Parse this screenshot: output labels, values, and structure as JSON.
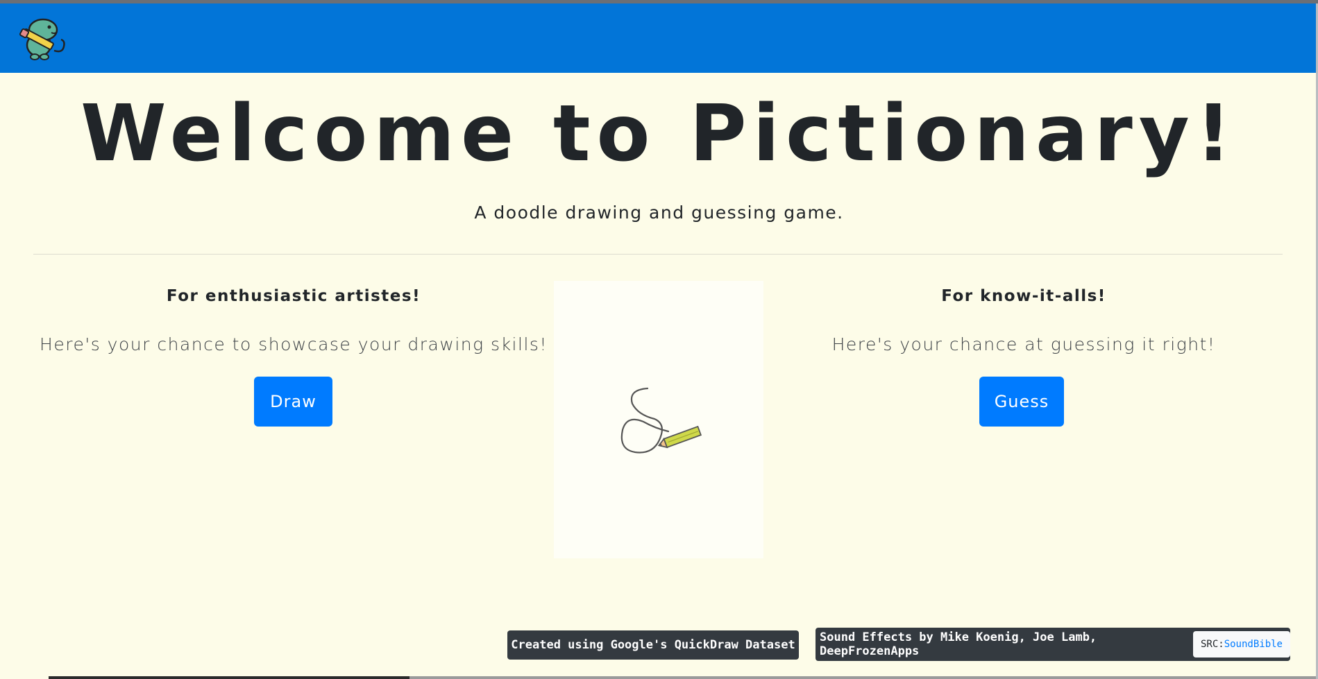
{
  "navbar": {
    "logo_icon": "dino-pencil-logo-icon",
    "color": "#0275d8"
  },
  "hero": {
    "title": "Welcome to Pictionary!",
    "subtitle": "A doodle drawing and guessing game."
  },
  "draw_section": {
    "heading": "For enthusiastic artistes!",
    "text": "Here's your chance to showcase your drawing skills!",
    "button_label": "Draw"
  },
  "guess_section": {
    "heading": "For know-it-alls!",
    "text": "Here's your chance at guessing it right!",
    "button_label": "Guess"
  },
  "illustration": {
    "icon": "pencil-doodle-icon"
  },
  "footer": {
    "dataset_credit": "Created using Google's QuickDraw Dataset",
    "sound_credit": "Sound Effects by Mike Koenig, Joe Lamb, DeepFrozenApps",
    "src_prefix": "SRC:",
    "src_link": "SoundBible"
  },
  "colors": {
    "accent": "#007bff",
    "background": "#fdfce8",
    "badge": "#343a40"
  }
}
